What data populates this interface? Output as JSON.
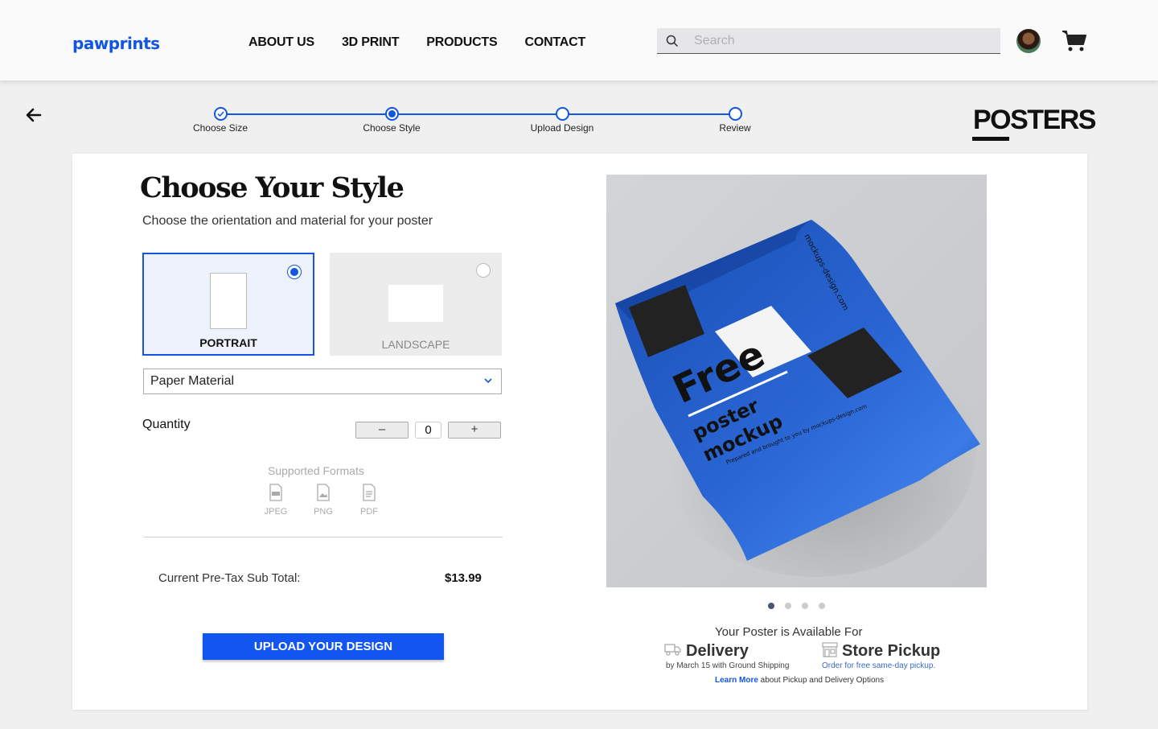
{
  "header": {
    "logo": "pawprints",
    "nav": [
      "ABOUT US",
      "3D PRINT",
      "PRODUCTS",
      "CONTACT"
    ],
    "search_placeholder": "Search"
  },
  "stepper": {
    "steps": [
      "Choose Size",
      "Choose Style",
      "Upload Design",
      "Review"
    ],
    "current_step": 2
  },
  "page_title": "POSTERS",
  "main": {
    "heading": "Choose Your Style",
    "subheading": "Choose the orientation and material for your poster",
    "orientation": {
      "portrait_label": "PORTRAIT",
      "landscape_label": "LANDSCAPE",
      "selected": "PORTRAIT"
    },
    "material_select": "Paper Material",
    "quantity_label": "Quantity",
    "quantity_value": "0",
    "decrement_symbol": "–",
    "increment_symbol": "+",
    "formats_title": "Supported Formats",
    "formats": [
      "JPEG",
      "PNG",
      "PDF"
    ],
    "subtotal_label": "Current Pre-Tax Sub Total:",
    "subtotal_value": "$13.99",
    "upload_button": "UPLOAD YOUR DESIGN"
  },
  "preview": {
    "poster_watermark": "mockups-design.com",
    "poster_headline": "Free",
    "poster_sub1": "poster",
    "poster_sub2": "mockup",
    "poster_small": "Prepared and brought to you by mockups-design.com",
    "carousel_count": 4,
    "carousel_active": 1
  },
  "availability": {
    "title": "Your Poster is Available For",
    "delivery_title": "Delivery",
    "delivery_sub": "by March 15 with Ground Shipping",
    "pickup_title": "Store Pickup",
    "pickup_sub": "Order for free same-day pickup.",
    "learn_link": "Learn More",
    "learn_rest": " about Pickup and Delivery Options"
  },
  "colors": {
    "accent": "#1256e0",
    "button": "#1256ef",
    "poster_blue": "#1e5bc6"
  }
}
